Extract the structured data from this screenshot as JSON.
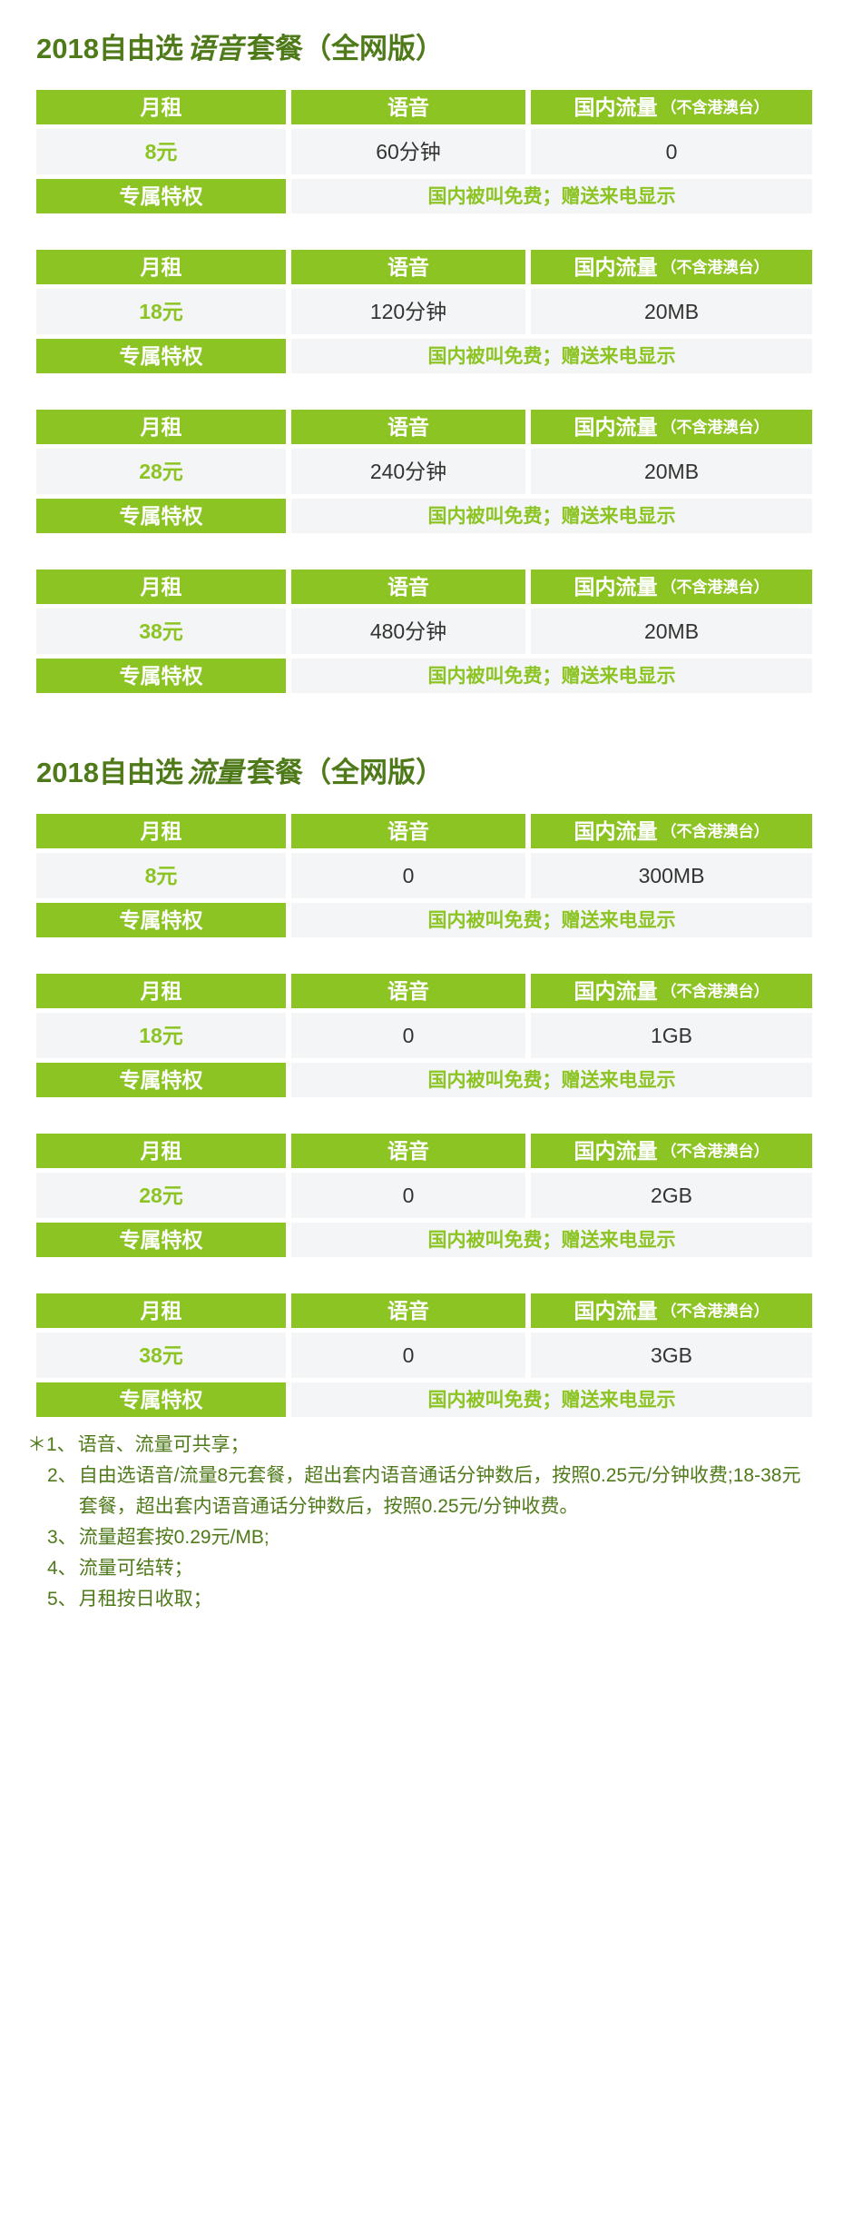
{
  "page": {
    "background": "#ffffff",
    "accent_green": "#8cc424",
    "title_green": "#4f7a19",
    "cell_background": "#f4f5f6",
    "value_text_color": "#333333"
  },
  "sections": [
    {
      "id": "voice",
      "title_prefix": "2018自由选",
      "title_emphasis": "语音",
      "title_suffix": "套餐（全网版）",
      "title_full": "2018自由选 语音 套餐（全网版）",
      "columns": {
        "monthly_fee": "月租",
        "voice": "语音",
        "data_main": "国内流量",
        "data_sub": "（不含港澳台）"
      },
      "privilege_label": "专属特权",
      "privilege_value": "国内被叫免费；赠送来电显示",
      "plans": [
        {
          "monthly_fee": "8元",
          "voice": "60分钟",
          "data": "0"
        },
        {
          "monthly_fee": "18元",
          "voice": "120分钟",
          "data": "20MB"
        },
        {
          "monthly_fee": "28元",
          "voice": "240分钟",
          "data": "20MB"
        },
        {
          "monthly_fee": "38元",
          "voice": "480分钟",
          "data": "20MB"
        }
      ]
    },
    {
      "id": "data",
      "title_prefix": "2018自由选",
      "title_emphasis": "流量",
      "title_suffix": "套餐（全网版）",
      "title_full": "2018自由选 流量 套餐（全网版）",
      "columns": {
        "monthly_fee": "月租",
        "voice": "语音",
        "data_main": "国内流量",
        "data_sub": "（不含港澳台）"
      },
      "privilege_label": "专属特权",
      "privilege_value": "国内被叫免费；赠送来电显示",
      "plans": [
        {
          "monthly_fee": "8元",
          "voice": "0",
          "data": "300MB"
        },
        {
          "monthly_fee": "18元",
          "voice": "0",
          "data": "1GB"
        },
        {
          "monthly_fee": "28元",
          "voice": "0",
          "data": "2GB"
        },
        {
          "monthly_fee": "38元",
          "voice": "0",
          "data": "3GB"
        }
      ]
    }
  ],
  "notes": {
    "items": [
      {
        "marker": "＊1、",
        "text": "语音、流量可共享；"
      },
      {
        "marker": "2、",
        "text": "自由选语音/流量8元套餐，超出套内语音通话分钟数后，按照0.25元/分钟收费;18-38元套餐，超出套内语音通话分钟数后，按照0.25元/分钟收费。"
      },
      {
        "marker": "3、",
        "text": "流量超套按0.29元/MB;"
      },
      {
        "marker": "4、",
        "text": "流量可结转；"
      },
      {
        "marker": "5、",
        "text": "月租按日收取；"
      }
    ]
  }
}
